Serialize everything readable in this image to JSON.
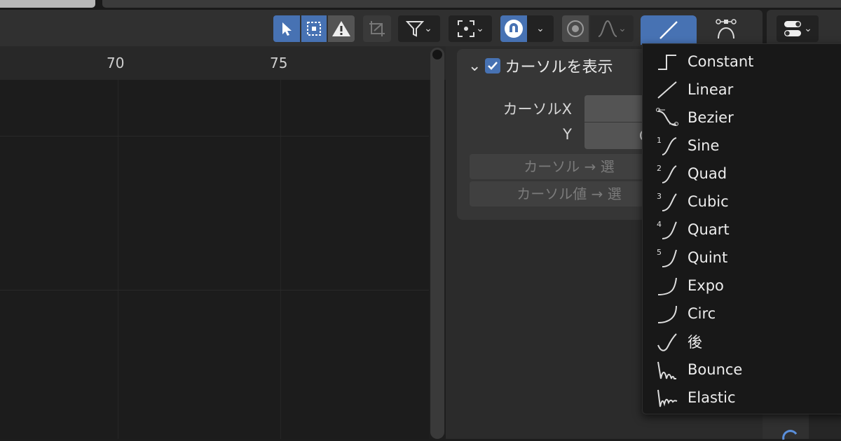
{
  "header": {
    "tools": [
      "select-icon",
      "box-select-icon",
      "warning-icon",
      "crop-icon",
      "filter-icon",
      "snap-target-icon",
      "snap-magnet-icon",
      "proportional-icon",
      "falloff-curve-icon",
      "linear-interp-icon",
      "bezier-handle-icon",
      "view-options-icon"
    ]
  },
  "ruler": {
    "ticks": [
      "70",
      "75"
    ]
  },
  "cursor_panel": {
    "title": "カーソルを表示",
    "show_cursor_checked": true,
    "cursor_x_label": "カーソルX",
    "cursor_y_label": "Y",
    "cursor_y_value": "C",
    "cursor_to_selected": "カーソル → 選",
    "cursor_value_to_selected": "カーソル値 → 選"
  },
  "interpolation_menu": {
    "items": [
      {
        "label": "Constant",
        "icon": "constant-icon"
      },
      {
        "label": "Linear",
        "icon": "linear-icon"
      },
      {
        "label": "Bezier",
        "icon": "bezier-icon"
      },
      {
        "label": "Sine",
        "icon": "sine-icon"
      },
      {
        "label": "Quad",
        "icon": "quad-icon"
      },
      {
        "label": "Cubic",
        "icon": "cubic-icon"
      },
      {
        "label": "Quart",
        "icon": "quart-icon"
      },
      {
        "label": "Quint",
        "icon": "quint-icon"
      },
      {
        "label": "Expo",
        "icon": "expo-icon"
      },
      {
        "label": "Circ",
        "icon": "circ-icon"
      },
      {
        "label": "後",
        "icon": "back-icon"
      },
      {
        "label": "Bounce",
        "icon": "bounce-icon"
      },
      {
        "label": "Elastic",
        "icon": "elastic-icon"
      }
    ]
  },
  "colors": {
    "accent": "#4772b3",
    "background": "#1d1d1d",
    "menu": "#181818"
  }
}
